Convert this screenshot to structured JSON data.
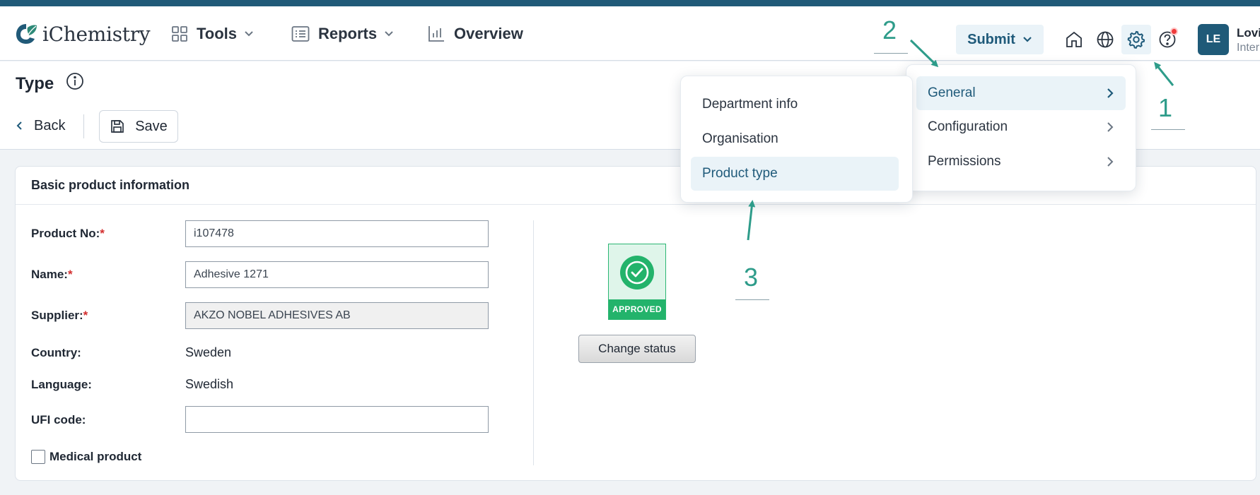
{
  "app": {
    "name": "iChemistry"
  },
  "nav": {
    "tools": "Tools",
    "reports": "Reports",
    "overview": "Overview",
    "submit": "Submit"
  },
  "user": {
    "initials": "LE",
    "name": "Lovi",
    "role": "Inter"
  },
  "page": {
    "title": "Type",
    "back": "Back",
    "save": "Save"
  },
  "card": {
    "title": "Basic product information",
    "fields": {
      "product_no_label": "Product No:",
      "product_no_value": "i107478",
      "name_label": "Name:",
      "name_value": "Adhesive 1271",
      "supplier_label": "Supplier:",
      "supplier_value": "AKZO NOBEL ADHESIVES AB",
      "country_label": "Country:",
      "country_value": "Sweden",
      "language_label": "Language:",
      "language_value": "Swedish",
      "ufi_label": "UFI code:",
      "ufi_value": "",
      "medical_label": "Medical product",
      "required_mark": "*"
    },
    "status": {
      "badge": "APPROVED",
      "change": "Change status"
    }
  },
  "settings_menu": {
    "items": [
      "General",
      "Configuration",
      "Permissions"
    ]
  },
  "general_submenu": {
    "items": [
      "Department info",
      "Organisation",
      "Product type"
    ]
  },
  "annotations": {
    "step1": "1",
    "step2": "2",
    "step3": "3"
  },
  "colors": {
    "brand": "#215a78",
    "accent_bg": "#eaf3f8",
    "approved": "#23b36b",
    "annotation": "#2e9c8a",
    "required": "#d32f2f",
    "notification": "#ef3b3b"
  },
  "icons": {
    "logo": "ichemistry-logo-icon",
    "tools": "grid-icon",
    "reports": "list-icon",
    "overview": "bar-chart-icon",
    "home": "home-icon",
    "language": "globe-icon",
    "settings": "gear-icon",
    "help": "help-icon",
    "info": "info-icon",
    "back": "chevron-left-icon",
    "save": "floppy-disk-icon",
    "submenu": "chevron-right-icon",
    "approved": "check-circle-icon"
  }
}
